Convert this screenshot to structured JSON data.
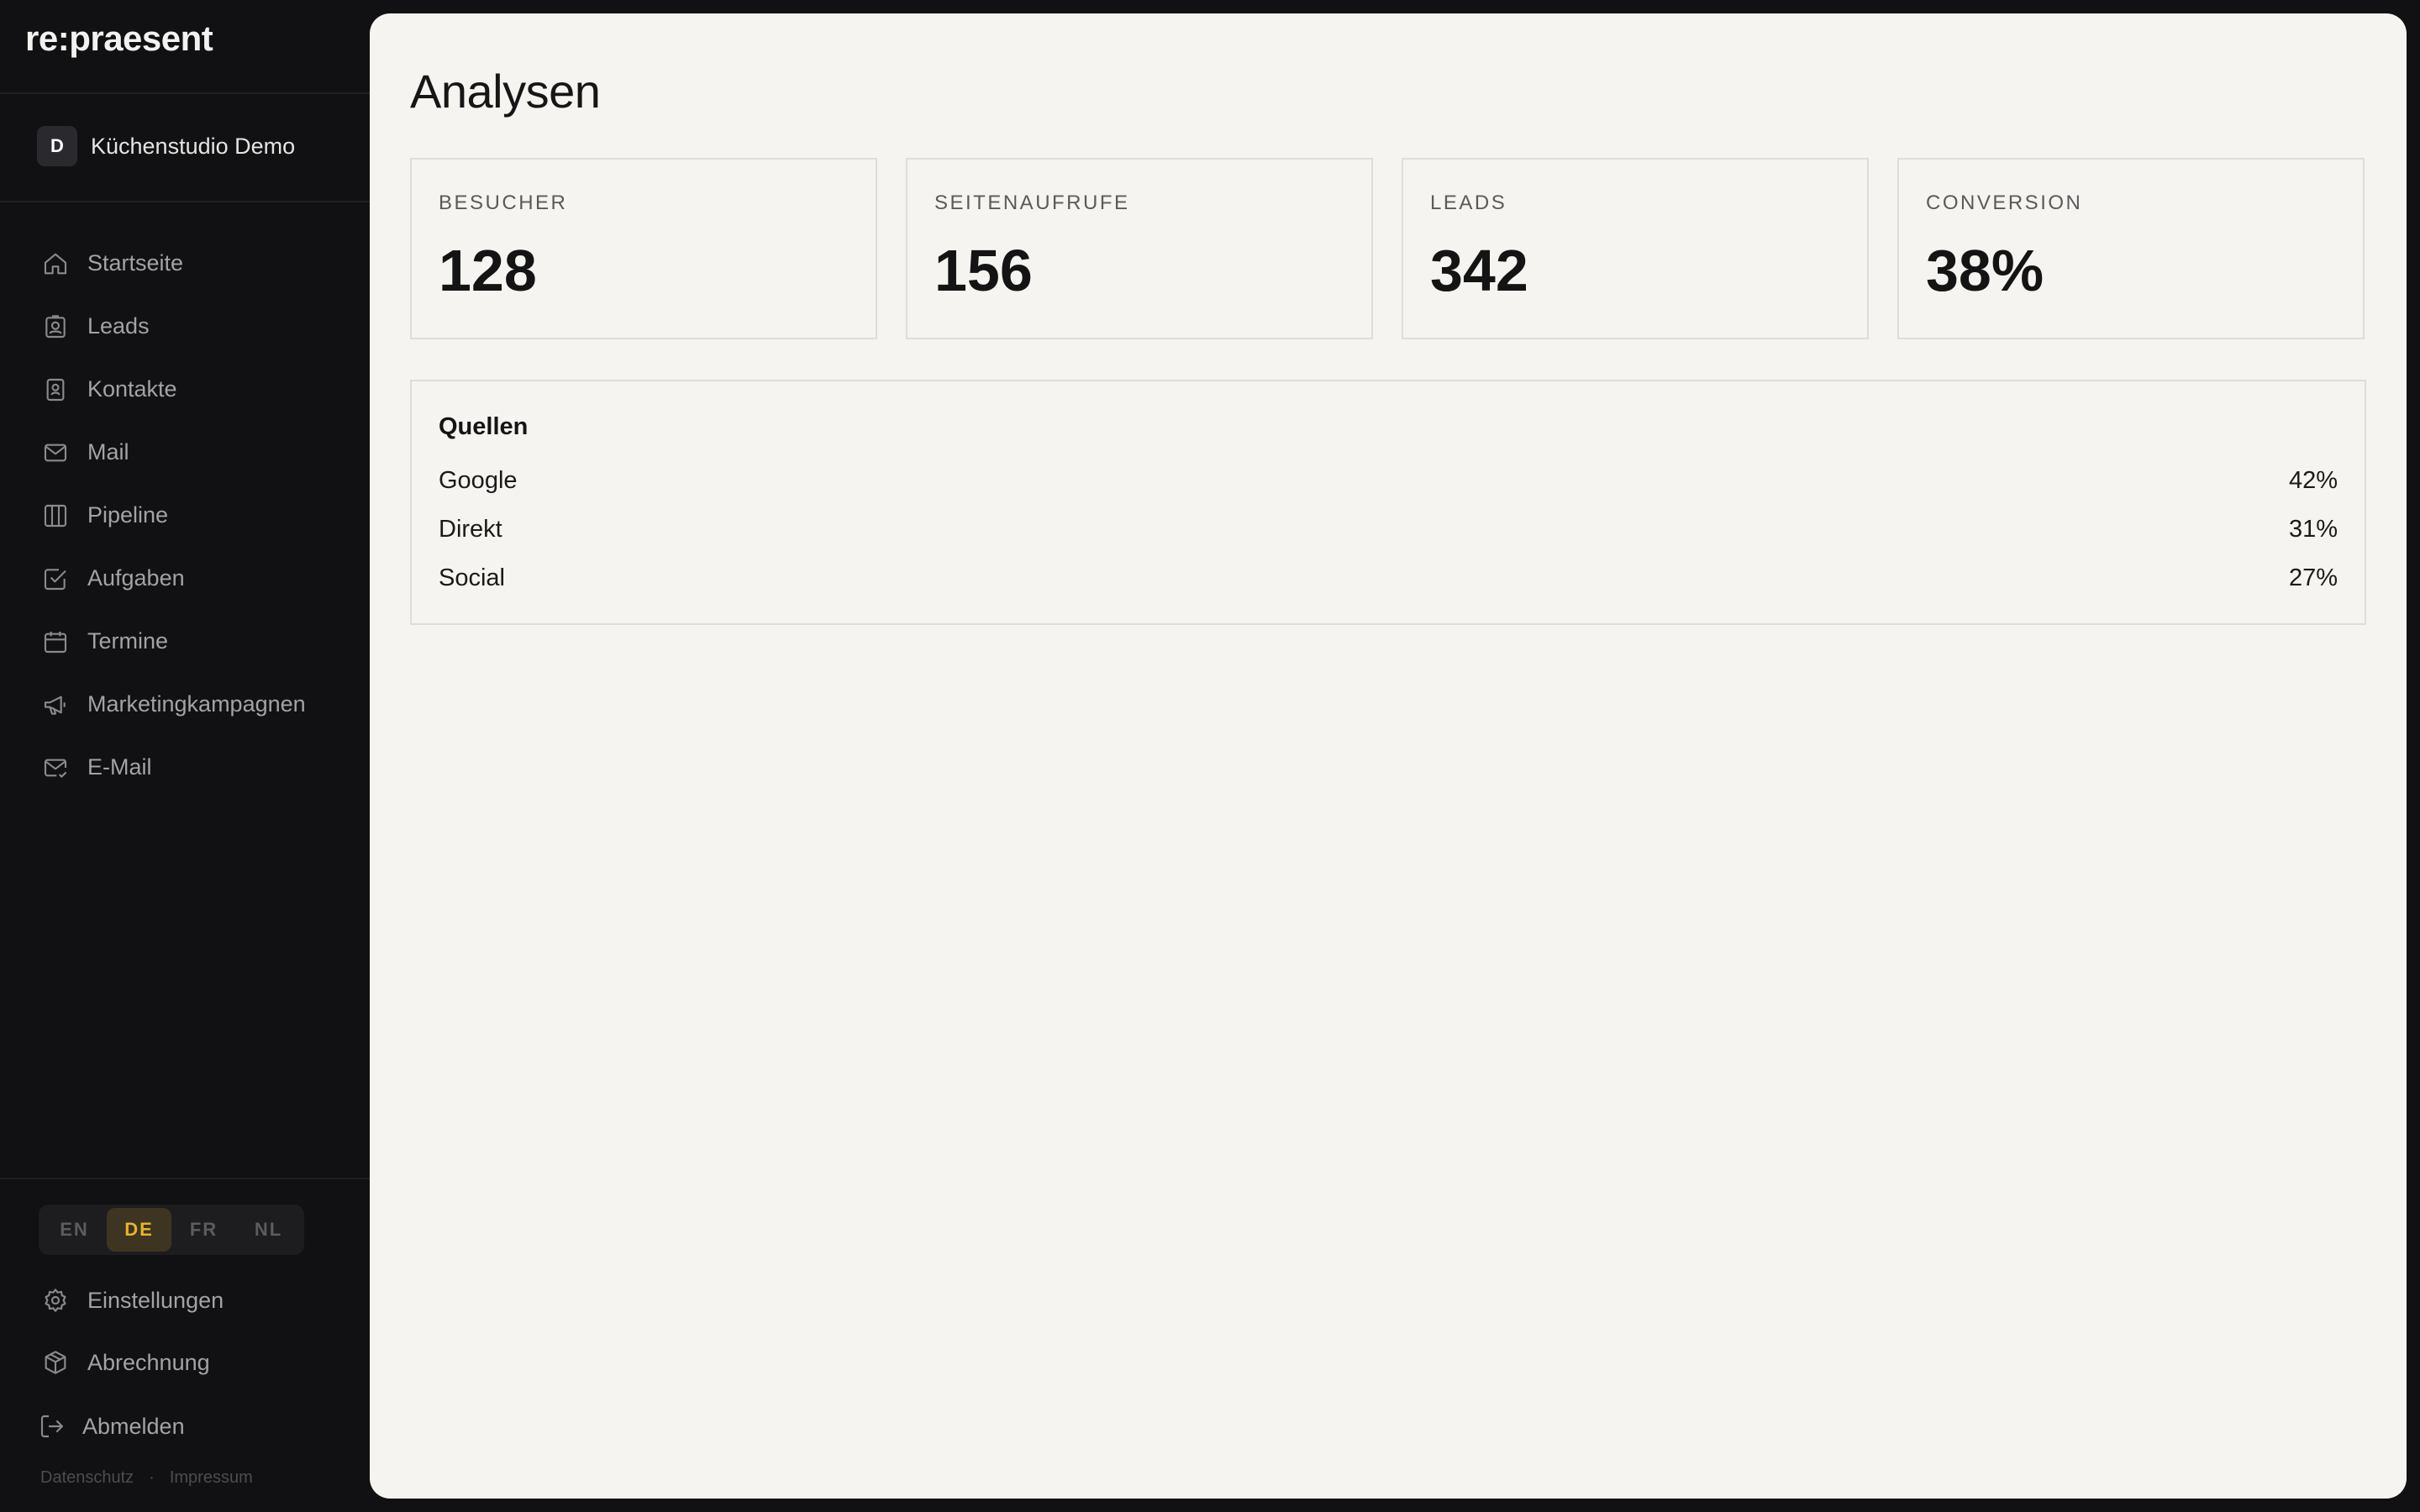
{
  "app": {
    "brand": "re:praesent"
  },
  "workspace": {
    "initial": "D",
    "name": "Küchenstudio Demo"
  },
  "sidebar": {
    "items": [
      {
        "label": "Startseite",
        "icon": "home-icon"
      },
      {
        "label": "Leads",
        "icon": "lead-badge-icon"
      },
      {
        "label": "Kontakte",
        "icon": "contacts-icon"
      },
      {
        "label": "Mail",
        "icon": "mail-icon"
      },
      {
        "label": "Pipeline",
        "icon": "columns-icon"
      },
      {
        "label": "Aufgaben",
        "icon": "checkbox-icon"
      },
      {
        "label": "Termine",
        "icon": "calendar-icon"
      },
      {
        "label": "Marketingkampagnen",
        "icon": "megaphone-icon"
      },
      {
        "label": "E-Mail",
        "icon": "mail-check-icon"
      }
    ],
    "languages": [
      "EN",
      "DE",
      "FR",
      "NL"
    ],
    "active_language": "DE",
    "settings_label": "Einstellungen",
    "billing_label": "Abrechnung",
    "logout_label": "Abmelden",
    "footer": {
      "privacy": "Datenschutz",
      "separator": "·",
      "imprint": "Impressum"
    }
  },
  "main": {
    "title": "Analysen",
    "stats": [
      {
        "label": "BESUCHER",
        "value": "128"
      },
      {
        "label": "SEITENAUFRUFE",
        "value": "156"
      },
      {
        "label": "LEADS",
        "value": "342"
      },
      {
        "label": "CONVERSION",
        "value": "38%"
      }
    ],
    "sources": {
      "title": "Quellen",
      "rows": [
        {
          "name": "Google",
          "share": "42%"
        },
        {
          "name": "Direkt",
          "share": "31%"
        },
        {
          "name": "Social",
          "share": "27%"
        }
      ]
    }
  },
  "colors": {
    "sidebar_bg": "#111113",
    "content_bg": "#f5f4f0",
    "accent": "#e6b32a",
    "border": "#deddd8"
  }
}
